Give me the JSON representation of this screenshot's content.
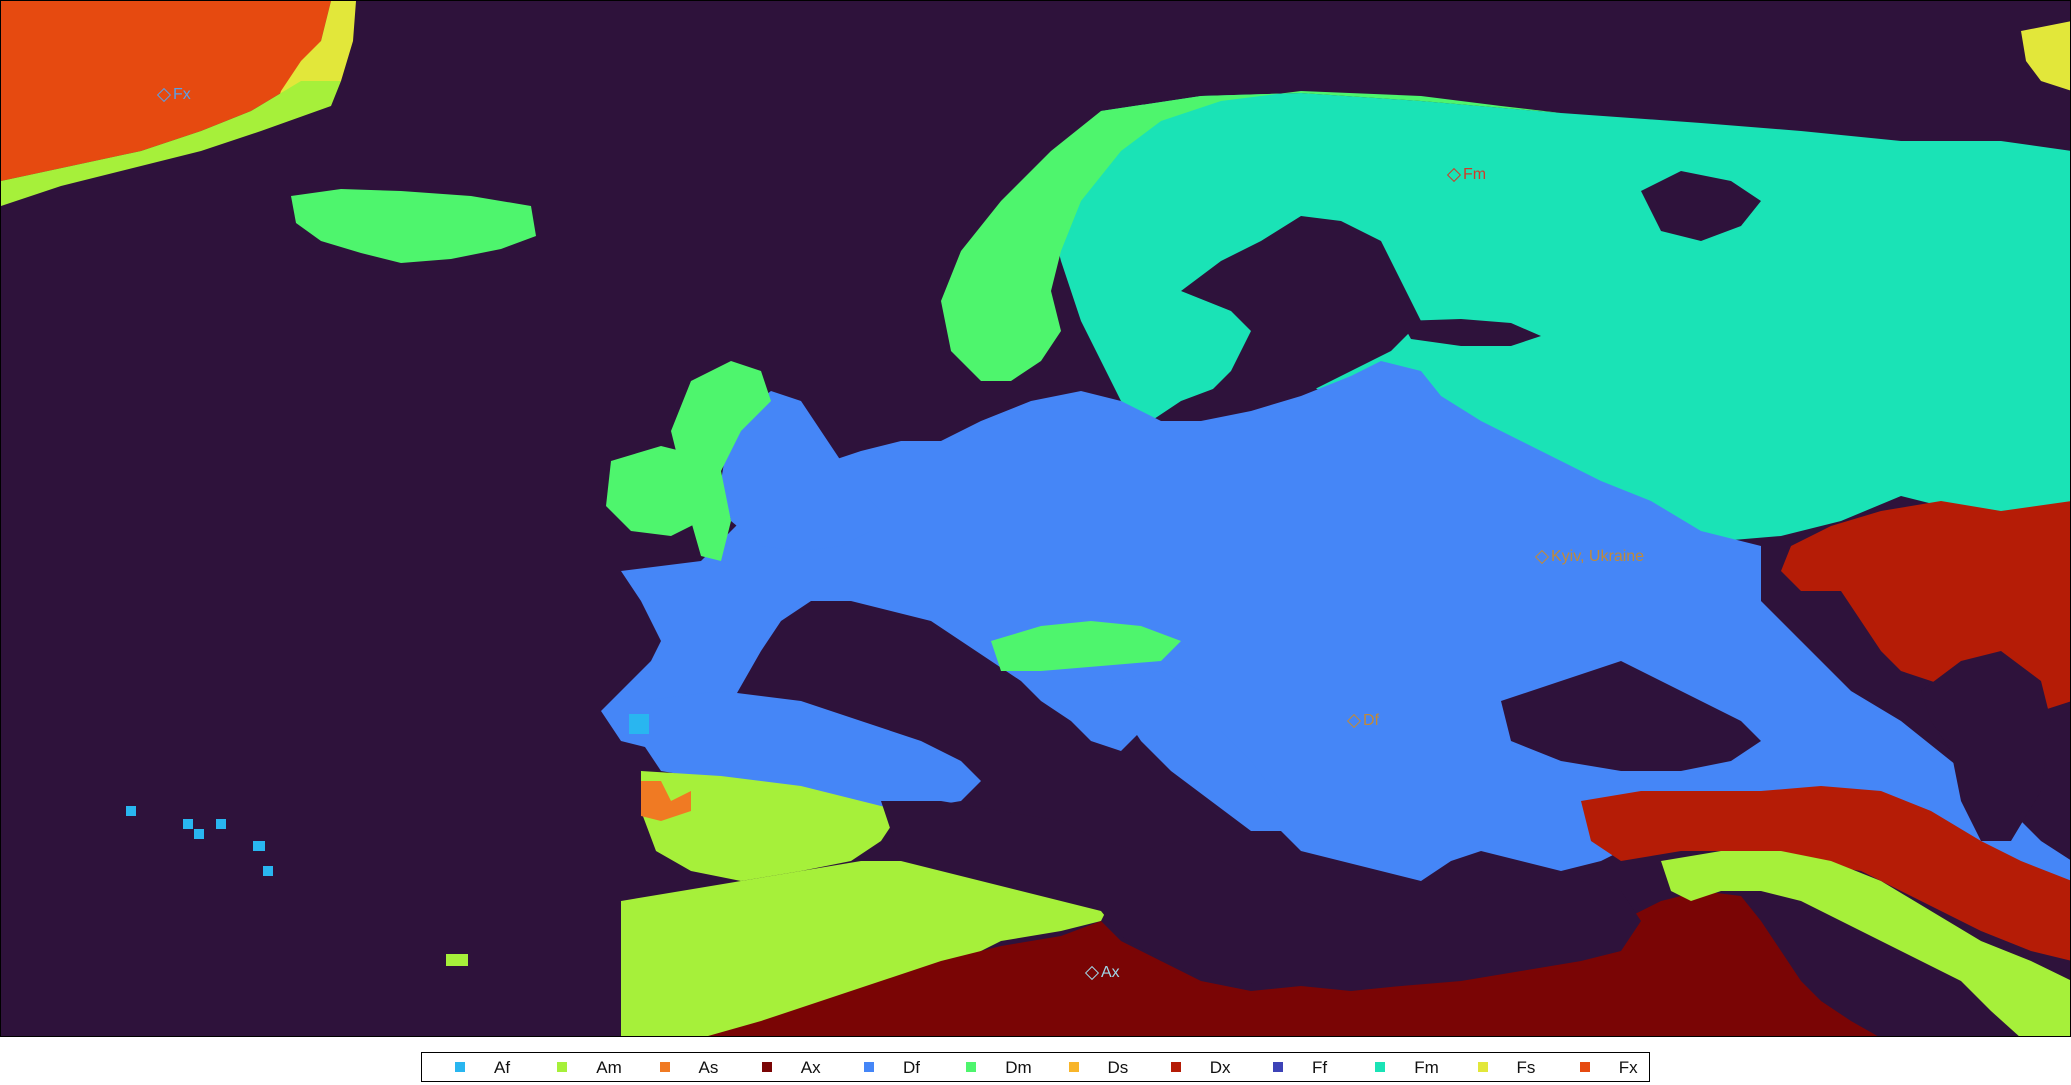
{
  "map": {
    "ocean_color": "#2e123b",
    "labels": [
      {
        "id": "fx",
        "text": "Fx",
        "color": "#5aa0e6"
      },
      {
        "id": "fm",
        "text": "Fm",
        "color": "#d03b2a"
      },
      {
        "id": "kyiv",
        "text": "Kyiv, Ukraine",
        "color": "#c08a3a"
      },
      {
        "id": "df",
        "text": "Df",
        "color": "#c08a3a"
      },
      {
        "id": "ax",
        "text": "Ax",
        "color": "#9fd7e8"
      }
    ]
  },
  "legend": {
    "items": [
      {
        "label": "Af",
        "color": "#29b6f0"
      },
      {
        "label": "Am",
        "color": "#a6f03a"
      },
      {
        "label": "As",
        "color": "#f07a23"
      },
      {
        "label": "Ax",
        "color": "#7a0505"
      },
      {
        "label": "Df",
        "color": "#4586f7"
      },
      {
        "label": "Dm",
        "color": "#4ef56d"
      },
      {
        "label": "Ds",
        "color": "#f8b52a"
      },
      {
        "label": "Dx",
        "color": "#b51c06"
      },
      {
        "label": "Ff",
        "color": "#3d43b7"
      },
      {
        "label": "Fm",
        "color": "#1ae3b6"
      },
      {
        "label": "Fs",
        "color": "#e2e73a"
      },
      {
        "label": "Fx",
        "color": "#e64a10"
      }
    ]
  }
}
